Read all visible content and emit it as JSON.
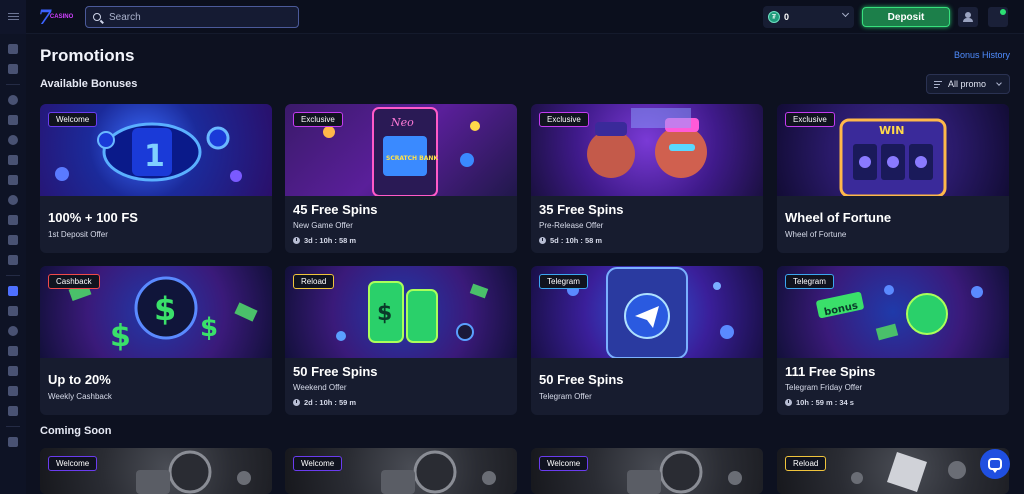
{
  "header": {
    "search_placeholder": "Search",
    "balance": "0",
    "deposit_label": "Deposit",
    "logo_text": "CASINO"
  },
  "page": {
    "title": "Promotions",
    "bonus_history": "Bonus History"
  },
  "sections": {
    "available": "Available Bonuses",
    "coming_soon": "Coming Soon"
  },
  "filter": {
    "label": "All promo"
  },
  "cards": [
    {
      "badge": "Welcome",
      "title": "100% + 100 FS",
      "sub": "1st Deposit Offer",
      "timer": ""
    },
    {
      "badge": "Exclusive",
      "title": "45 Free Spins",
      "sub": "New Game Offer",
      "timer": "3d : 10h : 58 m"
    },
    {
      "badge": "Exclusive",
      "title": "35 Free Spins",
      "sub": "Pre-Release Offer",
      "timer": "5d : 10h : 58 m"
    },
    {
      "badge": "Exclusive",
      "title": "Wheel of Fortune",
      "sub": "Wheel of Fortune",
      "timer": ""
    },
    {
      "badge": "Cashback",
      "title": "Up to 20%",
      "sub": "Weekly Cashback",
      "timer": ""
    },
    {
      "badge": "Reload",
      "title": "50 Free Spins",
      "sub": "Weekend Offer",
      "timer": "2d : 10h : 59 m"
    },
    {
      "badge": "Telegram",
      "title": "50 Free Spins",
      "sub": "Telegram Offer",
      "timer": ""
    },
    {
      "badge": "Telegram",
      "title": "111 Free Spins",
      "sub": "Telegram Friday Offer",
      "timer": "10h : 59 m : 34 s"
    }
  ],
  "coming_cards": [
    {
      "badge": "Welcome"
    },
    {
      "badge": "Welcome"
    },
    {
      "badge": "Welcome"
    },
    {
      "badge": "Reload"
    }
  ],
  "art_text": {
    "scratch": "SCRATCH BANK",
    "neon": "Neo",
    "win": "WIN",
    "bonus": "bonus"
  },
  "colors": {
    "background": "#0d1120",
    "card": "#171c2f",
    "deposit": "#1c7f4a",
    "link": "#4f8dff"
  },
  "icons": [
    "menu-icon",
    "search-icon",
    "coin-icon",
    "user-icon",
    "notification-icon",
    "filter-icon",
    "clock-icon",
    "chat-icon"
  ]
}
